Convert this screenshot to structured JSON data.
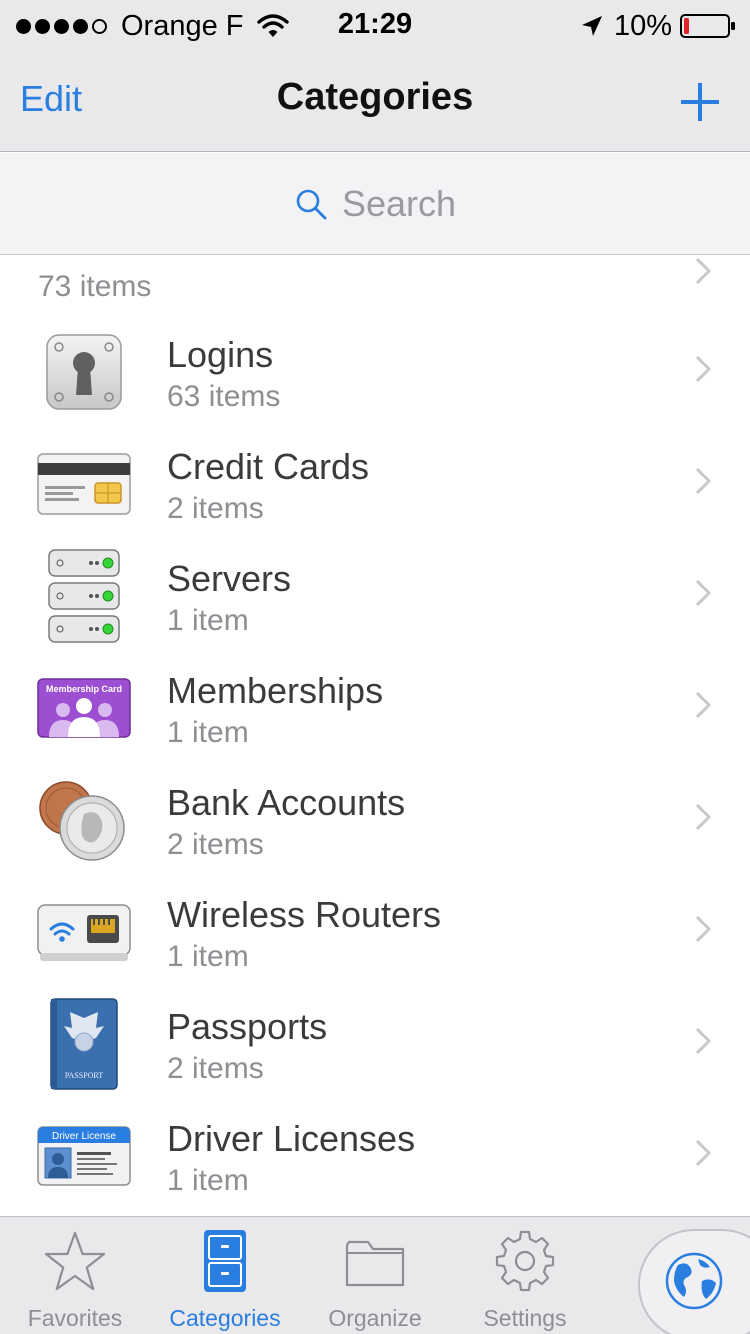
{
  "status_bar": {
    "carrier": "Orange F",
    "time": "21:29",
    "battery_percent": "10%",
    "signal_bars_filled": 4,
    "signal_bars_total": 5,
    "battery_level": 0.1
  },
  "nav": {
    "edit_label": "Edit",
    "title": "Categories",
    "add_icon": "plus-icon"
  },
  "search": {
    "placeholder": "Search"
  },
  "list": {
    "partial_count": "73 items",
    "items": [
      {
        "title": "Logins",
        "count": "63 items",
        "icon": "login-keyhole-icon"
      },
      {
        "title": "Credit Cards",
        "count": "2 items",
        "icon": "credit-card-icon"
      },
      {
        "title": "Servers",
        "count": "1 item",
        "icon": "server-icon"
      },
      {
        "title": "Memberships",
        "count": "1 item",
        "icon": "membership-card-icon",
        "icon_text": "Membership Card"
      },
      {
        "title": "Bank Accounts",
        "count": "2 items",
        "icon": "coins-icon"
      },
      {
        "title": "Wireless Routers",
        "count": "1 item",
        "icon": "router-icon"
      },
      {
        "title": "Passports",
        "count": "2 items",
        "icon": "passport-icon",
        "icon_text": "PASSPORT"
      },
      {
        "title": "Driver Licenses",
        "count": "1 item",
        "icon": "driver-license-icon",
        "icon_text": "Driver License"
      }
    ]
  },
  "tabs": [
    {
      "label": "Favorites",
      "icon": "star-icon",
      "active": false
    },
    {
      "label": "Categories",
      "icon": "file-cabinet-icon",
      "active": true
    },
    {
      "label": "Organize",
      "icon": "folder-icon",
      "active": false
    },
    {
      "label": "Settings",
      "icon": "gear-icon",
      "active": false
    }
  ],
  "globe_button": {
    "icon": "globe-icon"
  },
  "colors": {
    "accent": "#2a7ee0",
    "bar_background": "#e9e9eb",
    "secondary_text": "#8e8e93",
    "battery_low": "#e0242a"
  }
}
